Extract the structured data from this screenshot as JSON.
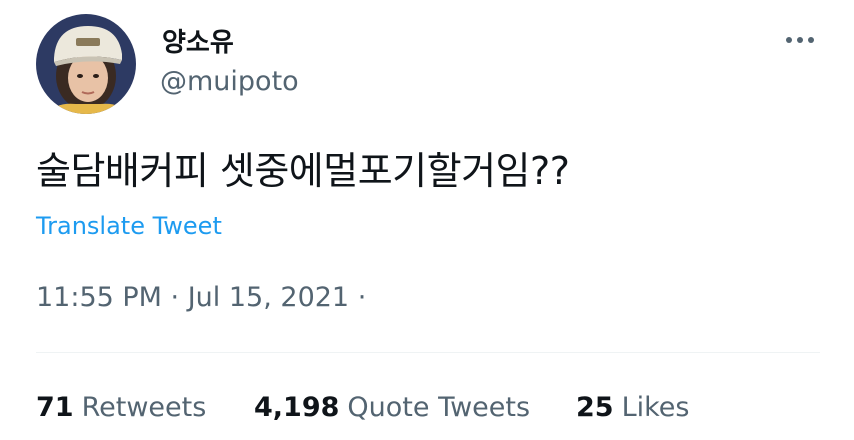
{
  "user": {
    "display_name": "양소유",
    "handle": "@muipoto"
  },
  "tweet": {
    "text": "술담배커피 셋중에멀포기할거임??",
    "translate_label": "Translate Tweet",
    "timestamp": "11:55 PM · Jul 15, 2021 ·"
  },
  "stats": {
    "retweets_count": "71",
    "retweets_label": "Retweets",
    "quotes_count": "4,198",
    "quotes_label": "Quote Tweets",
    "likes_count": "25",
    "likes_label": "Likes"
  },
  "icons": {
    "more": "more-horizontal-icon"
  },
  "colors": {
    "link": "#1d9bf0",
    "secondary_text": "#536471",
    "primary_text": "#0f1419"
  }
}
